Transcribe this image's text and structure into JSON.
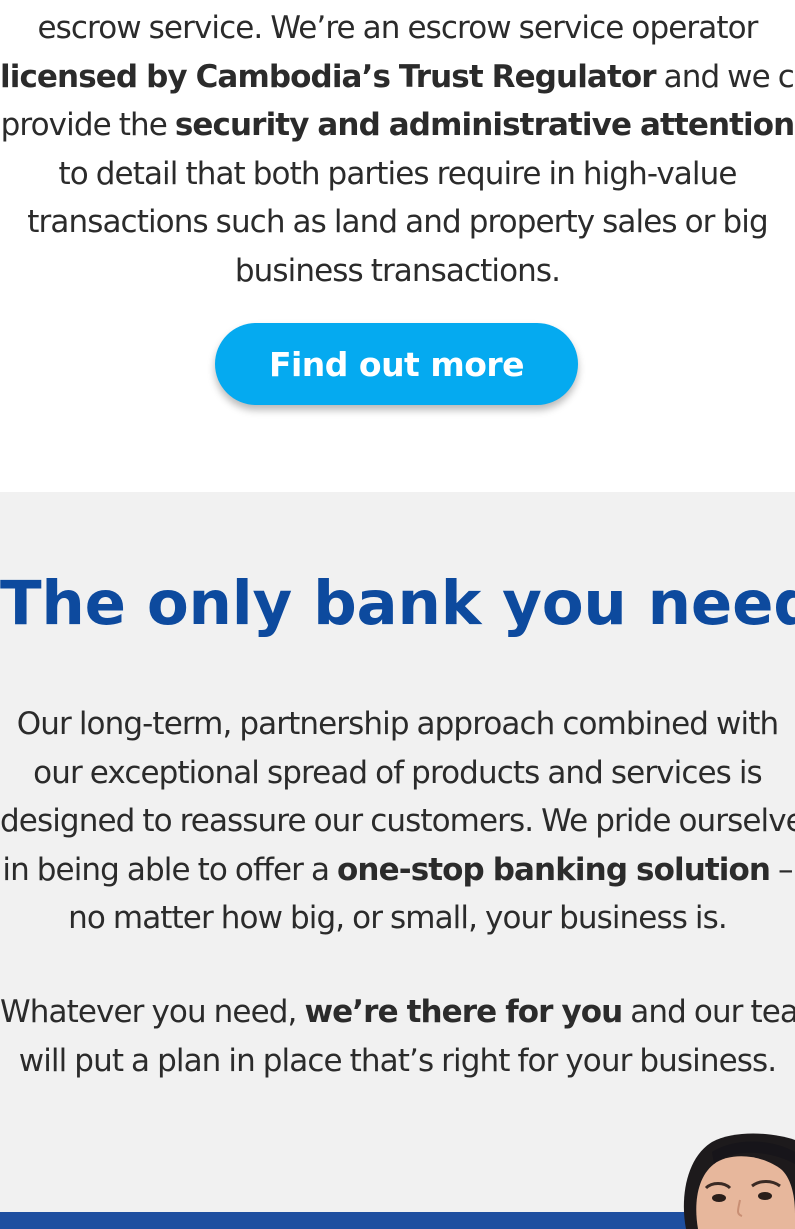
{
  "escrow": {
    "line1": "escrow service. We’re an escrow service operator",
    "line2_bold": "licensed by Cambodia’s Trust Regulator",
    "line2_rest": " and we can",
    "line3_pre": "provide the ",
    "line3_bold": "security and administrative attention",
    "line4": "to detail that both parties require in high-value",
    "line5": "transactions such as land and property sales or big",
    "line6": "business transactions.",
    "cta_label": "Find out more"
  },
  "bank": {
    "heading": "The only bank you need",
    "p1_line1": "Our long-term, partnership approach combined with",
    "p1_line2": "our exceptional spread of products and services is",
    "p1_line3": "designed to reassure our customers. We pride ourselves",
    "p1_line4_pre": "in being able to offer a ",
    "p1_line4_bold": "one-stop banking solution",
    "p1_line4_post": " –",
    "p1_line5": "no matter how big, or small, your business is.",
    "p2_line1_pre": "Whatever you need, ",
    "p2_line1_bold": "we’re there for you",
    "p2_line1_post": " and our team",
    "p2_line2": "will put a plan in place that’s right for your business."
  },
  "colors": {
    "accent_button": "#05aaf0",
    "heading_blue": "#0d4a9e",
    "section_bg": "#f1f1f1",
    "banner_blue": "#1e4fa0"
  },
  "icons": [
    "person-photo"
  ]
}
